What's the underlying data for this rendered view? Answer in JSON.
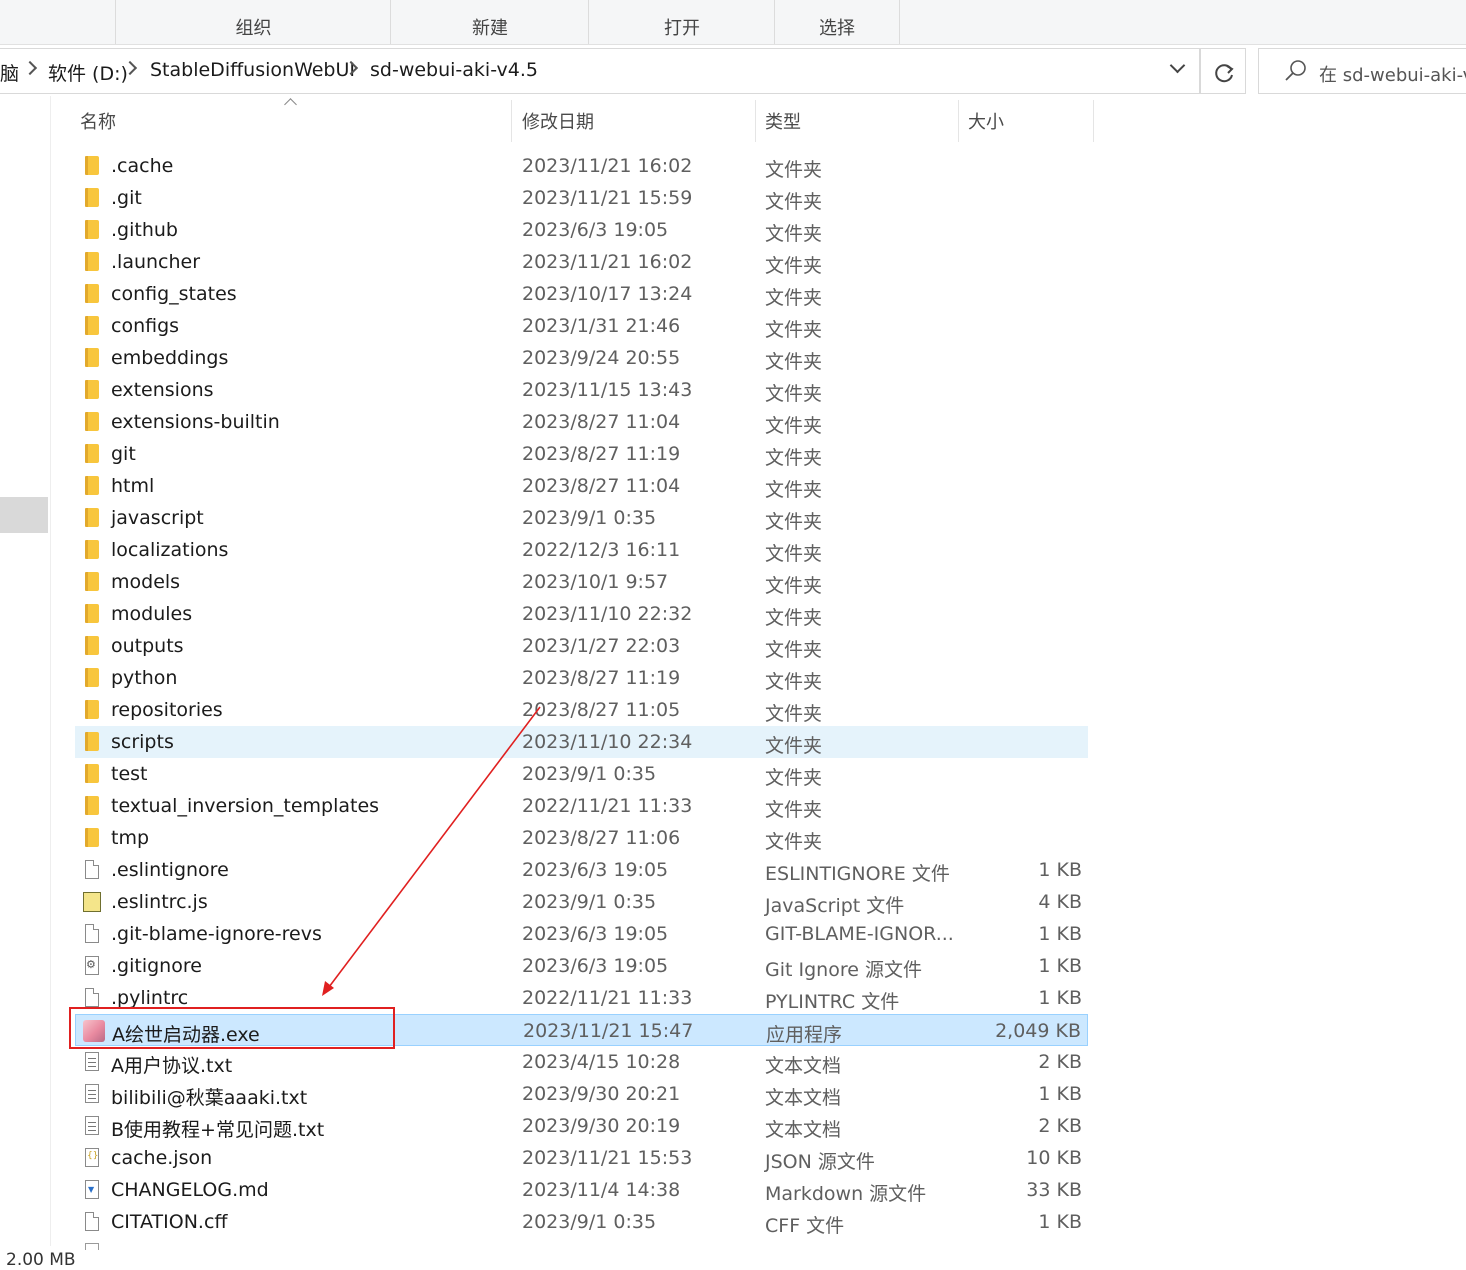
{
  "ribbon": {
    "groups": [
      "组织",
      "新建",
      "打开",
      "选择"
    ]
  },
  "address": {
    "crumbs": [
      "脑",
      "软件 (D:)",
      "StableDiffusionWebUI",
      "sd-webui-aki-v4.5"
    ]
  },
  "search": {
    "placeholder": "在 sd-webui-aki-v"
  },
  "columns": {
    "name": "名称",
    "date": "修改日期",
    "type": "类型",
    "size": "大小"
  },
  "files": [
    {
      "name": ".cache",
      "date": "2023/11/21 16:02",
      "type": "文件夹",
      "size": "",
      "icon": "folder"
    },
    {
      "name": ".git",
      "date": "2023/11/21 15:59",
      "type": "文件夹",
      "size": "",
      "icon": "folder"
    },
    {
      "name": ".github",
      "date": "2023/6/3 19:05",
      "type": "文件夹",
      "size": "",
      "icon": "folder"
    },
    {
      "name": ".launcher",
      "date": "2023/11/21 16:02",
      "type": "文件夹",
      "size": "",
      "icon": "folder"
    },
    {
      "name": "config_states",
      "date": "2023/10/17 13:24",
      "type": "文件夹",
      "size": "",
      "icon": "folder"
    },
    {
      "name": "configs",
      "date": "2023/1/31 21:46",
      "type": "文件夹",
      "size": "",
      "icon": "folder"
    },
    {
      "name": "embeddings",
      "date": "2023/9/24 20:55",
      "type": "文件夹",
      "size": "",
      "icon": "folder"
    },
    {
      "name": "extensions",
      "date": "2023/11/15 13:43",
      "type": "文件夹",
      "size": "",
      "icon": "folder"
    },
    {
      "name": "extensions-builtin",
      "date": "2023/8/27 11:04",
      "type": "文件夹",
      "size": "",
      "icon": "folder"
    },
    {
      "name": "git",
      "date": "2023/8/27 11:19",
      "type": "文件夹",
      "size": "",
      "icon": "folder"
    },
    {
      "name": "html",
      "date": "2023/8/27 11:04",
      "type": "文件夹",
      "size": "",
      "icon": "folder"
    },
    {
      "name": "javascript",
      "date": "2023/9/1 0:35",
      "type": "文件夹",
      "size": "",
      "icon": "folder"
    },
    {
      "name": "localizations",
      "date": "2022/12/3 16:11",
      "type": "文件夹",
      "size": "",
      "icon": "folder"
    },
    {
      "name": "models",
      "date": "2023/10/1 9:57",
      "type": "文件夹",
      "size": "",
      "icon": "folder"
    },
    {
      "name": "modules",
      "date": "2023/11/10 22:32",
      "type": "文件夹",
      "size": "",
      "icon": "folder"
    },
    {
      "name": "outputs",
      "date": "2023/1/27 22:03",
      "type": "文件夹",
      "size": "",
      "icon": "folder"
    },
    {
      "name": "python",
      "date": "2023/8/27 11:19",
      "type": "文件夹",
      "size": "",
      "icon": "folder"
    },
    {
      "name": "repositories",
      "date": "2023/8/27 11:05",
      "type": "文件夹",
      "size": "",
      "icon": "folder"
    },
    {
      "name": "scripts",
      "date": "2023/11/10 22:34",
      "type": "文件夹",
      "size": "",
      "icon": "folder",
      "state": "hover"
    },
    {
      "name": "test",
      "date": "2023/9/1 0:35",
      "type": "文件夹",
      "size": "",
      "icon": "folder"
    },
    {
      "name": "textual_inversion_templates",
      "date": "2022/11/21 11:33",
      "type": "文件夹",
      "size": "",
      "icon": "folder"
    },
    {
      "name": "tmp",
      "date": "2023/8/27 11:06",
      "type": "文件夹",
      "size": "",
      "icon": "folder"
    },
    {
      "name": ".eslintignore",
      "date": "2023/6/3 19:05",
      "type": "ESLINTIGNORE 文件",
      "size": "1 KB",
      "icon": "file"
    },
    {
      "name": ".eslintrc.js",
      "date": "2023/9/1 0:35",
      "type": "JavaScript 文件",
      "size": "4 KB",
      "icon": "js"
    },
    {
      "name": ".git-blame-ignore-revs",
      "date": "2023/6/3 19:05",
      "type": "GIT-BLAME-IGNOR...",
      "size": "1 KB",
      "icon": "file"
    },
    {
      "name": ".gitignore",
      "date": "2023/6/3 19:05",
      "type": "Git Ignore 源文件",
      "size": "1 KB",
      "icon": "gear"
    },
    {
      "name": ".pylintrc",
      "date": "2022/11/21 11:33",
      "type": "PYLINTRC 文件",
      "size": "1 KB",
      "icon": "file"
    },
    {
      "name": "A绘世启动器.exe",
      "date": "2023/11/21 15:47",
      "type": "应用程序",
      "size": "2,049 KB",
      "icon": "exe",
      "state": "selected"
    },
    {
      "name": "A用户协议.txt",
      "date": "2023/4/15 10:28",
      "type": "文本文档",
      "size": "2 KB",
      "icon": "txt"
    },
    {
      "name": "bilibili@秋葉aaaki.txt",
      "date": "2023/9/30 20:21",
      "type": "文本文档",
      "size": "1 KB",
      "icon": "txt"
    },
    {
      "name": "B使用教程+常见问题.txt",
      "date": "2023/9/30 20:19",
      "type": "文本文档",
      "size": "2 KB",
      "icon": "txt"
    },
    {
      "name": "cache.json",
      "date": "2023/11/21 15:53",
      "type": "JSON 源文件",
      "size": "10 KB",
      "icon": "json"
    },
    {
      "name": "CHANGELOG.md",
      "date": "2023/11/4 14:38",
      "type": "Markdown 源文件",
      "size": "33 KB",
      "icon": "md"
    },
    {
      "name": "CITATION.cff",
      "date": "2023/9/1 0:35",
      "type": "CFF 文件",
      "size": "1 KB",
      "icon": "file"
    }
  ],
  "status": {
    "selection_size": "2.00 MB"
  },
  "colors": {
    "annotation": "#e02020",
    "selected_row": "#cce8ff",
    "hover_row": "#e5f3fb",
    "folder": "#f8c63d"
  }
}
